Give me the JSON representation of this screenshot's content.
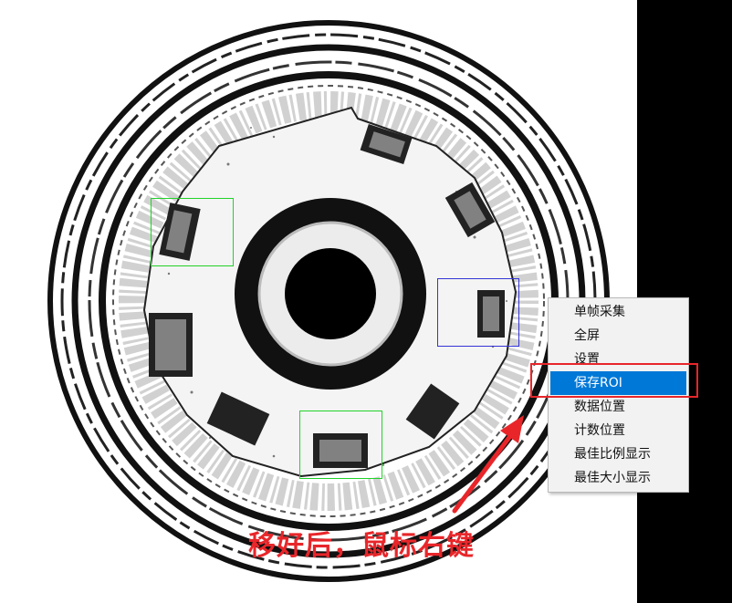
{
  "context_menu": {
    "items": [
      {
        "label": "单帧采集",
        "selected": false
      },
      {
        "label": "全屏",
        "selected": false
      },
      {
        "label": "设置",
        "selected": false
      },
      {
        "label": "保存ROI",
        "selected": true
      },
      {
        "label": "数据位置",
        "selected": false
      },
      {
        "label": "计数位置",
        "selected": false
      },
      {
        "label": "最佳比例显示",
        "selected": false
      },
      {
        "label": "最佳大小显示",
        "selected": false
      }
    ]
  },
  "annotation": {
    "text": "移好后，鼠标右键"
  },
  "colors": {
    "roi_green": "#22d22a",
    "roi_blue": "#3434d6",
    "annotation_red": "#e8262a",
    "menu_selected": "#0078d7"
  }
}
